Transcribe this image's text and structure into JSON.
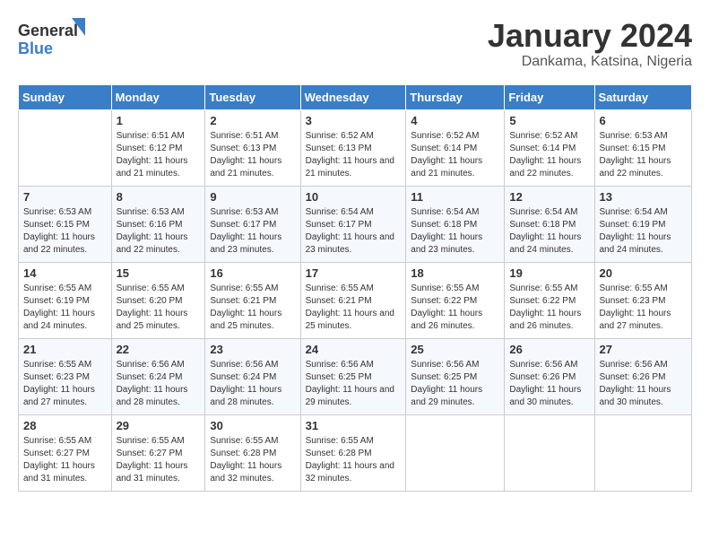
{
  "header": {
    "logo_line1": "General",
    "logo_line2": "Blue",
    "title": "January 2024",
    "subtitle": "Dankama, Katsina, Nigeria"
  },
  "weekdays": [
    "Sunday",
    "Monday",
    "Tuesday",
    "Wednesday",
    "Thursday",
    "Friday",
    "Saturday"
  ],
  "weeks": [
    [
      {
        "day": "",
        "sunrise": "",
        "sunset": "",
        "daylight": ""
      },
      {
        "day": "1",
        "sunrise": "Sunrise: 6:51 AM",
        "sunset": "Sunset: 6:12 PM",
        "daylight": "Daylight: 11 hours and 21 minutes."
      },
      {
        "day": "2",
        "sunrise": "Sunrise: 6:51 AM",
        "sunset": "Sunset: 6:13 PM",
        "daylight": "Daylight: 11 hours and 21 minutes."
      },
      {
        "day": "3",
        "sunrise": "Sunrise: 6:52 AM",
        "sunset": "Sunset: 6:13 PM",
        "daylight": "Daylight: 11 hours and 21 minutes."
      },
      {
        "day": "4",
        "sunrise": "Sunrise: 6:52 AM",
        "sunset": "Sunset: 6:14 PM",
        "daylight": "Daylight: 11 hours and 21 minutes."
      },
      {
        "day": "5",
        "sunrise": "Sunrise: 6:52 AM",
        "sunset": "Sunset: 6:14 PM",
        "daylight": "Daylight: 11 hours and 22 minutes."
      },
      {
        "day": "6",
        "sunrise": "Sunrise: 6:53 AM",
        "sunset": "Sunset: 6:15 PM",
        "daylight": "Daylight: 11 hours and 22 minutes."
      }
    ],
    [
      {
        "day": "7",
        "sunrise": "Sunrise: 6:53 AM",
        "sunset": "Sunset: 6:15 PM",
        "daylight": "Daylight: 11 hours and 22 minutes."
      },
      {
        "day": "8",
        "sunrise": "Sunrise: 6:53 AM",
        "sunset": "Sunset: 6:16 PM",
        "daylight": "Daylight: 11 hours and 22 minutes."
      },
      {
        "day": "9",
        "sunrise": "Sunrise: 6:53 AM",
        "sunset": "Sunset: 6:17 PM",
        "daylight": "Daylight: 11 hours and 23 minutes."
      },
      {
        "day": "10",
        "sunrise": "Sunrise: 6:54 AM",
        "sunset": "Sunset: 6:17 PM",
        "daylight": "Daylight: 11 hours and 23 minutes."
      },
      {
        "day": "11",
        "sunrise": "Sunrise: 6:54 AM",
        "sunset": "Sunset: 6:18 PM",
        "daylight": "Daylight: 11 hours and 23 minutes."
      },
      {
        "day": "12",
        "sunrise": "Sunrise: 6:54 AM",
        "sunset": "Sunset: 6:18 PM",
        "daylight": "Daylight: 11 hours and 24 minutes."
      },
      {
        "day": "13",
        "sunrise": "Sunrise: 6:54 AM",
        "sunset": "Sunset: 6:19 PM",
        "daylight": "Daylight: 11 hours and 24 minutes."
      }
    ],
    [
      {
        "day": "14",
        "sunrise": "Sunrise: 6:55 AM",
        "sunset": "Sunset: 6:19 PM",
        "daylight": "Daylight: 11 hours and 24 minutes."
      },
      {
        "day": "15",
        "sunrise": "Sunrise: 6:55 AM",
        "sunset": "Sunset: 6:20 PM",
        "daylight": "Daylight: 11 hours and 25 minutes."
      },
      {
        "day": "16",
        "sunrise": "Sunrise: 6:55 AM",
        "sunset": "Sunset: 6:21 PM",
        "daylight": "Daylight: 11 hours and 25 minutes."
      },
      {
        "day": "17",
        "sunrise": "Sunrise: 6:55 AM",
        "sunset": "Sunset: 6:21 PM",
        "daylight": "Daylight: 11 hours and 25 minutes."
      },
      {
        "day": "18",
        "sunrise": "Sunrise: 6:55 AM",
        "sunset": "Sunset: 6:22 PM",
        "daylight": "Daylight: 11 hours and 26 minutes."
      },
      {
        "day": "19",
        "sunrise": "Sunrise: 6:55 AM",
        "sunset": "Sunset: 6:22 PM",
        "daylight": "Daylight: 11 hours and 26 minutes."
      },
      {
        "day": "20",
        "sunrise": "Sunrise: 6:55 AM",
        "sunset": "Sunset: 6:23 PM",
        "daylight": "Daylight: 11 hours and 27 minutes."
      }
    ],
    [
      {
        "day": "21",
        "sunrise": "Sunrise: 6:55 AM",
        "sunset": "Sunset: 6:23 PM",
        "daylight": "Daylight: 11 hours and 27 minutes."
      },
      {
        "day": "22",
        "sunrise": "Sunrise: 6:56 AM",
        "sunset": "Sunset: 6:24 PM",
        "daylight": "Daylight: 11 hours and 28 minutes."
      },
      {
        "day": "23",
        "sunrise": "Sunrise: 6:56 AM",
        "sunset": "Sunset: 6:24 PM",
        "daylight": "Daylight: 11 hours and 28 minutes."
      },
      {
        "day": "24",
        "sunrise": "Sunrise: 6:56 AM",
        "sunset": "Sunset: 6:25 PM",
        "daylight": "Daylight: 11 hours and 29 minutes."
      },
      {
        "day": "25",
        "sunrise": "Sunrise: 6:56 AM",
        "sunset": "Sunset: 6:25 PM",
        "daylight": "Daylight: 11 hours and 29 minutes."
      },
      {
        "day": "26",
        "sunrise": "Sunrise: 6:56 AM",
        "sunset": "Sunset: 6:26 PM",
        "daylight": "Daylight: 11 hours and 30 minutes."
      },
      {
        "day": "27",
        "sunrise": "Sunrise: 6:56 AM",
        "sunset": "Sunset: 6:26 PM",
        "daylight": "Daylight: 11 hours and 30 minutes."
      }
    ],
    [
      {
        "day": "28",
        "sunrise": "Sunrise: 6:55 AM",
        "sunset": "Sunset: 6:27 PM",
        "daylight": "Daylight: 11 hours and 31 minutes."
      },
      {
        "day": "29",
        "sunrise": "Sunrise: 6:55 AM",
        "sunset": "Sunset: 6:27 PM",
        "daylight": "Daylight: 11 hours and 31 minutes."
      },
      {
        "day": "30",
        "sunrise": "Sunrise: 6:55 AM",
        "sunset": "Sunset: 6:28 PM",
        "daylight": "Daylight: 11 hours and 32 minutes."
      },
      {
        "day": "31",
        "sunrise": "Sunrise: 6:55 AM",
        "sunset": "Sunset: 6:28 PM",
        "daylight": "Daylight: 11 hours and 32 minutes."
      },
      {
        "day": "",
        "sunrise": "",
        "sunset": "",
        "daylight": ""
      },
      {
        "day": "",
        "sunrise": "",
        "sunset": "",
        "daylight": ""
      },
      {
        "day": "",
        "sunrise": "",
        "sunset": "",
        "daylight": ""
      }
    ]
  ]
}
